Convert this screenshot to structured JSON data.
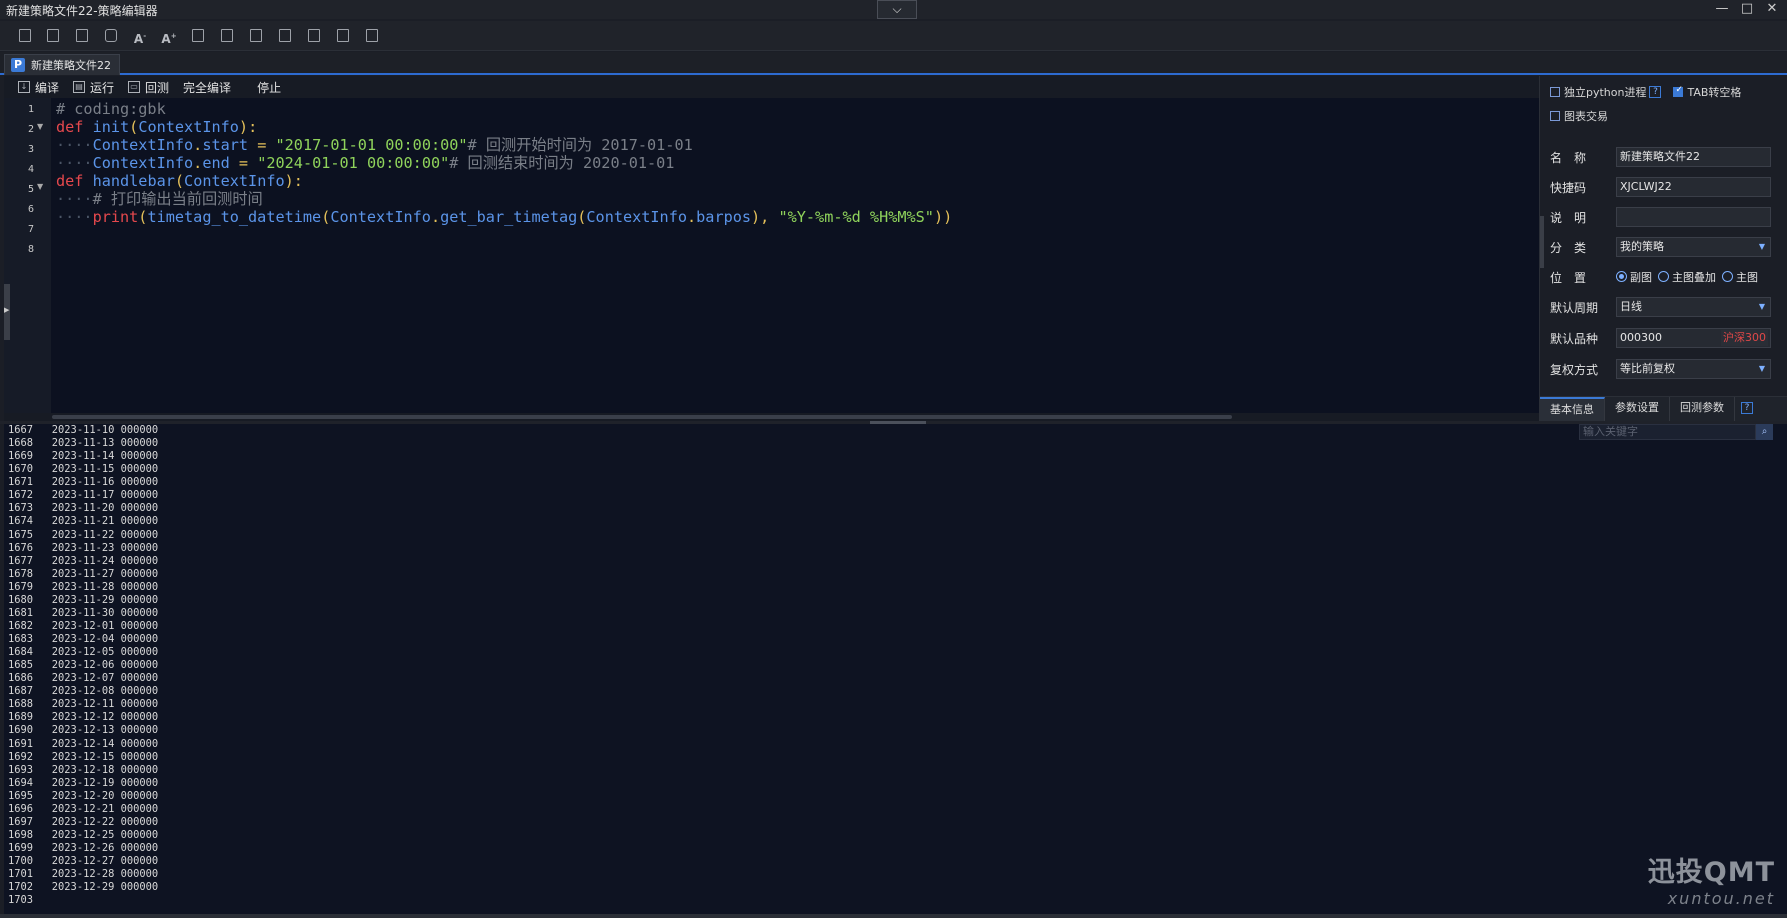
{
  "window": {
    "title": "新建策略文件22-策略编辑器",
    "dropdown_icon": "chevron-down",
    "controls": [
      "—",
      "□",
      "✕"
    ]
  },
  "toolbar": {
    "icons": [
      "save-icon",
      "save-as-icon",
      "save-all-icon",
      "copy-icon",
      "font-decrease-icon",
      "font-increase-icon",
      "import-icon",
      "export-icon",
      "search-file-icon",
      "doc-icon",
      "doc-list-icon",
      "doc-settings-icon",
      "doc-lock-icon"
    ]
  },
  "file_tab": {
    "icon": "P",
    "label": "新建策略文件22"
  },
  "editor_toolbar": {
    "compile": "编译",
    "run": "运行",
    "backtest": "回测",
    "full_compile": "完全编译",
    "stop": "停止"
  },
  "code": {
    "line_numbers": [
      "1",
      "2",
      "3",
      "4",
      "5",
      "6",
      "7",
      "8"
    ],
    "lines": [
      [
        {
          "t": "# coding:gbk",
          "c": "cm"
        }
      ],
      [
        {
          "t": "def",
          "c": "kw"
        },
        {
          "t": " ",
          "c": "ws"
        },
        {
          "t": "init",
          "c": "fn"
        },
        {
          "t": "(",
          "c": "pn"
        },
        {
          "t": "ContextInfo",
          "c": "id"
        },
        {
          "t": "):",
          "c": "pn"
        }
      ],
      [
        {
          "t": "····",
          "c": "ws"
        },
        {
          "t": "ContextInfo",
          "c": "id"
        },
        {
          "t": ".",
          "c": "op"
        },
        {
          "t": "start",
          "c": "id"
        },
        {
          "t": " ",
          "c": "ws"
        },
        {
          "t": "=",
          "c": "op"
        },
        {
          "t": " ",
          "c": "ws"
        },
        {
          "t": "\"2017-01-01 00:00:00\"",
          "c": "str"
        },
        {
          "t": "# 回测开始时间为 2017-01-01",
          "c": "cm"
        }
      ],
      [
        {
          "t": "····",
          "c": "ws"
        },
        {
          "t": "ContextInfo",
          "c": "id"
        },
        {
          "t": ".",
          "c": "op"
        },
        {
          "t": "end",
          "c": "id"
        },
        {
          "t": " ",
          "c": "ws"
        },
        {
          "t": "=",
          "c": "op"
        },
        {
          "t": " ",
          "c": "ws"
        },
        {
          "t": "\"2024-01-01 00:00:00\"",
          "c": "str"
        },
        {
          "t": "# 回测结束时间为 2020-01-01",
          "c": "cm"
        }
      ],
      [
        {
          "t": "def",
          "c": "kw"
        },
        {
          "t": " ",
          "c": "ws"
        },
        {
          "t": "handlebar",
          "c": "fn"
        },
        {
          "t": "(",
          "c": "pn"
        },
        {
          "t": "ContextInfo",
          "c": "id"
        },
        {
          "t": "):",
          "c": "pn"
        }
      ],
      [
        {
          "t": "····",
          "c": "ws"
        },
        {
          "t": "# 打印输出当前回测时间",
          "c": "cm"
        }
      ],
      [
        {
          "t": "····",
          "c": "ws"
        },
        {
          "t": "print",
          "c": "kw"
        },
        {
          "t": "(",
          "c": "pn"
        },
        {
          "t": "timetag_to_datetime",
          "c": "id"
        },
        {
          "t": "(",
          "c": "pn"
        },
        {
          "t": "ContextInfo",
          "c": "id"
        },
        {
          "t": ".",
          "c": "op"
        },
        {
          "t": "get_bar_timetag",
          "c": "id"
        },
        {
          "t": "(",
          "c": "pn"
        },
        {
          "t": "ContextInfo",
          "c": "id"
        },
        {
          "t": ".",
          "c": "op"
        },
        {
          "t": "barpos",
          "c": "id"
        },
        {
          "t": "),",
          "c": "pn"
        },
        {
          "t": " ",
          "c": "ws"
        },
        {
          "t": "\"%Y-%m-%d %H%M%S\"",
          "c": "str"
        },
        {
          "t": "))",
          "c": "pn"
        }
      ],
      []
    ]
  },
  "panel": {
    "independent_python": "独立python进程",
    "tab_to_space": "TAB转空格",
    "chart_trade": "图表交易",
    "name_label": "名　称",
    "name_value": "新建策略文件22",
    "shortcode_label": "快捷码",
    "shortcode_value": "XJCLWJ22",
    "desc_label": "说　明",
    "desc_value": "",
    "category_label": "分　类",
    "category_value": "我的策略",
    "position_label": "位　置",
    "position_options": [
      "副图",
      "主图叠加",
      "主图"
    ],
    "period_label": "默认周期",
    "period_value": "日线",
    "symbol_label": "默认品种",
    "symbol_value": "000300",
    "symbol_tag": "沪深300",
    "adjust_label": "复权方式",
    "adjust_value": "等比前复权",
    "tabs": [
      "基本信息",
      "参数设置",
      "回测参数"
    ],
    "tab_help": "?"
  },
  "output": {
    "search_placeholder": "输入关键字",
    "lines": [
      "1667   2023-11-10 000000",
      "1668   2023-11-13 000000",
      "1669   2023-11-14 000000",
      "1670   2023-11-15 000000",
      "1671   2023-11-16 000000",
      "1672   2023-11-17 000000",
      "1673   2023-11-20 000000",
      "1674   2023-11-21 000000",
      "1675   2023-11-22 000000",
      "1676   2023-11-23 000000",
      "1677   2023-11-24 000000",
      "1678   2023-11-27 000000",
      "1679   2023-11-28 000000",
      "1680   2023-11-29 000000",
      "1681   2023-11-30 000000",
      "1682   2023-12-01 000000",
      "1683   2023-12-04 000000",
      "1684   2023-12-05 000000",
      "1685   2023-12-06 000000",
      "1686   2023-12-07 000000",
      "1687   2023-12-08 000000",
      "1688   2023-12-11 000000",
      "1689   2023-12-12 000000",
      "1690   2023-12-13 000000",
      "1691   2023-12-14 000000",
      "1692   2023-12-15 000000",
      "1693   2023-12-18 000000",
      "1694   2023-12-19 000000",
      "1695   2023-12-20 000000",
      "1696   2023-12-21 000000",
      "1697   2023-12-22 000000",
      "1698   2023-12-25 000000",
      "1699   2023-12-26 000000",
      "1700   2023-12-27 000000",
      "1701   2023-12-28 000000",
      "1702   2023-12-29 000000",
      "1703"
    ]
  },
  "watermark": {
    "brand": "迅投QMT",
    "site": "xuntou.net"
  }
}
